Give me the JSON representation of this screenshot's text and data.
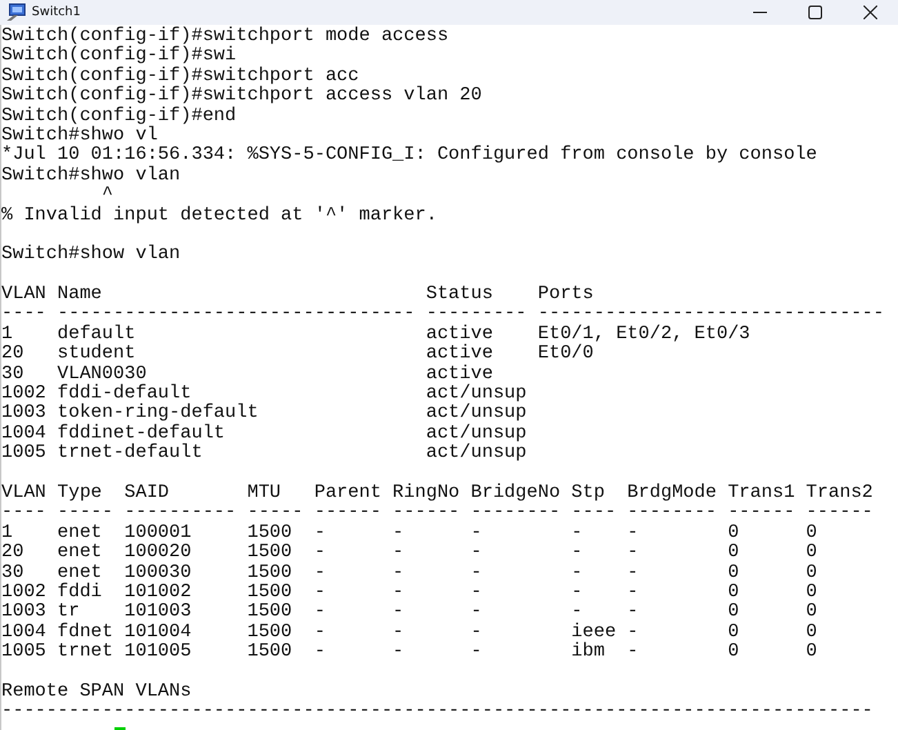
{
  "window": {
    "title": "Switch1"
  },
  "terminal": {
    "lines": [
      {
        "kind": "text",
        "text": "Switch(config-if)#switchport mode access"
      },
      {
        "kind": "text",
        "text": "Switch(config-if)#swi"
      },
      {
        "kind": "text",
        "text": "Switch(config-if)#switchport acc"
      },
      {
        "kind": "text",
        "text": "Switch(config-if)#switchport access vlan 20"
      },
      {
        "kind": "text",
        "text": "Switch(config-if)#end"
      },
      {
        "kind": "text",
        "text": "Switch#shwo vl"
      },
      {
        "kind": "text",
        "text": "*Jul 10 01:16:56.334: %SYS-5-CONFIG_I: Configured from console by console"
      },
      {
        "kind": "text",
        "text": "Switch#shwo vlan"
      },
      {
        "kind": "text",
        "text": "         ^"
      },
      {
        "kind": "text",
        "text": "% Invalid input detected at '^' marker."
      },
      {
        "kind": "blank"
      },
      {
        "kind": "text",
        "text": "Switch#show vlan"
      },
      {
        "kind": "blank"
      },
      {
        "kind": "text",
        "text": "VLAN Name                             Status    Ports"
      },
      {
        "kind": "text",
        "text": "---- -------------------------------- --------- -------------------------------"
      },
      {
        "kind": "text",
        "text": "1    default                          active    Et0/1, Et0/2, Et0/3"
      },
      {
        "kind": "text",
        "text": "20   student                          active    Et0/0"
      },
      {
        "kind": "text",
        "text": "30   VLAN0030                         active"
      },
      {
        "kind": "text",
        "text": "1002 fddi-default                     act/unsup"
      },
      {
        "kind": "text",
        "text": "1003 token-ring-default               act/unsup"
      },
      {
        "kind": "text",
        "text": "1004 fddinet-default                  act/unsup"
      },
      {
        "kind": "text",
        "text": "1005 trnet-default                    act/unsup"
      },
      {
        "kind": "blank"
      },
      {
        "kind": "text",
        "text": "VLAN Type  SAID       MTU   Parent RingNo BridgeNo Stp  BrdgMode Trans1 Trans2"
      },
      {
        "kind": "text",
        "text": "---- ----- ---------- ----- ------ ------ -------- ---- -------- ------ ------"
      },
      {
        "kind": "text",
        "text": "1    enet  100001     1500  -      -      -        -    -        0      0"
      },
      {
        "kind": "text",
        "text": "20   enet  100020     1500  -      -      -        -    -        0      0"
      },
      {
        "kind": "text",
        "text": "30   enet  100030     1500  -      -      -        -    -        0      0"
      },
      {
        "kind": "text",
        "text": "1002 fddi  101002     1500  -      -      -        -    -        0      0"
      },
      {
        "kind": "text",
        "text": "1003 tr    101003     1500  -      -      -        -    -        0      0"
      },
      {
        "kind": "text",
        "text": "1004 fdnet 101004     1500  -      -      -        ieee -        0      0"
      },
      {
        "kind": "text",
        "text": "1005 trnet 101005     1500  -      -      -        ibm  -        0      0"
      },
      {
        "kind": "blank"
      },
      {
        "kind": "text",
        "text": "Remote SPAN VLANs"
      },
      {
        "kind": "text",
        "text": "------------------------------------------------------------------------------"
      },
      {
        "kind": "cursor"
      }
    ]
  }
}
